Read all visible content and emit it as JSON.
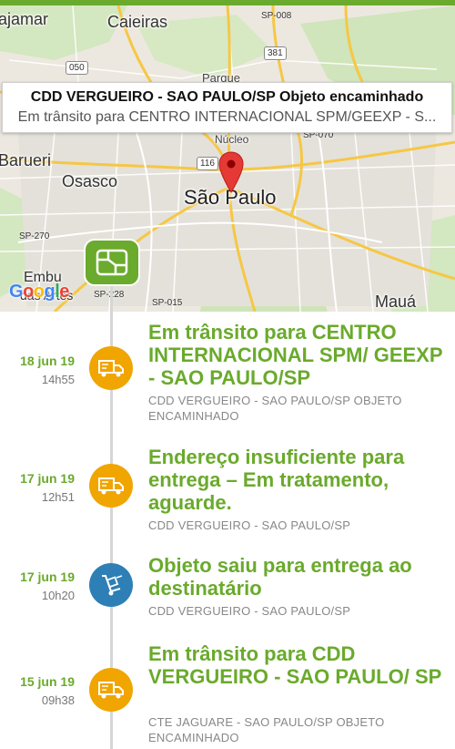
{
  "map": {
    "labels": {
      "jajamar": "ajamar",
      "caieiras": "Caieiras",
      "parque": "Parque",
      "nucleo": "Núcleo",
      "barueri": "Barueri",
      "osasco": "Osasco",
      "sao_paulo": "São Paulo",
      "embu": "Embu",
      "das_artes": "das Artes",
      "maua": "Mauá"
    },
    "shields": {
      "sp008": "SP-008",
      "r381": "381",
      "r050": "050",
      "sp070": "SP-070",
      "r116": "116",
      "sp270": "SP-270",
      "sp228": "SP-228",
      "sp015": "SP-015"
    },
    "google_logo": [
      "G",
      "o",
      "o",
      "g",
      "l",
      "e"
    ],
    "info_card": {
      "title": "CDD VERGUEIRO - SAO PAULO/SP Objeto encaminhado",
      "subtitle": "Em trânsito para CENTRO INTERNACIONAL SPM/GEEXP - S..."
    }
  },
  "colors": {
    "accent": "#6aaa2c",
    "orange": "#f0a500",
    "blue": "#2e7fb5"
  },
  "events": [
    {
      "date": "18 jun 19",
      "time": "14h55",
      "icon": "truck-icon",
      "title": "Em trânsito para CENTRO INTERNACIONAL SPM/ GEEXP - SAO PAULO/SP",
      "subtitle": "CDD VERGUEIRO - SAO PAULO/SP OBJETO ENCAMINHADO"
    },
    {
      "date": "17 jun 19",
      "time": "12h51",
      "icon": "truck-icon",
      "title": "Endereço insuficiente para entrega – Em tratamento, aguarde.",
      "subtitle": "CDD VERGUEIRO - SAO PAULO/SP"
    },
    {
      "date": "17 jun 19",
      "time": "10h20",
      "icon": "hand-truck-icon",
      "title": "Objeto saiu para entrega ao destinatário",
      "subtitle": "CDD VERGUEIRO - SAO PAULO/SP"
    },
    {
      "date": "15 jun 19",
      "time": "09h38",
      "icon": "truck-icon",
      "title": "Em trânsito para CDD VERGUEIRO - SAO PAULO/ SP",
      "subtitle": "CTE JAGUARE - SAO PAULO/SP OBJETO ENCAMINHADO"
    }
  ]
}
